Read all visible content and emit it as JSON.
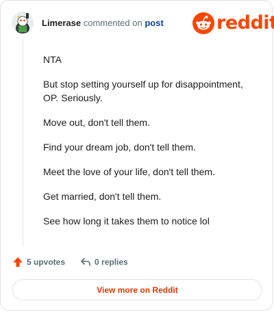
{
  "comment": {
    "username": "Limerase",
    "action_text": "commented on",
    "post_link_label": "post",
    "paragraphs": [
      "NTA",
      "But stop setting yourself up for disappointment, OP. Seriously.",
      "Move out, don't tell them.",
      "Find your dream job, don't tell them.",
      "Meet the love of your life, don't tell them.",
      "Get married, don't tell them.",
      "See how long it takes them to notice lol"
    ]
  },
  "brand": {
    "name": "reddit",
    "logo_icon": "reddit-snoo-icon",
    "color": "#ff4500"
  },
  "actions": {
    "upvotes_label": "5 upvotes",
    "upvote_icon": "upvote-arrow-icon",
    "upvote_color": "#ff4500",
    "replies_label": "0 replies",
    "reply_icon": "reply-arrow-icon"
  },
  "footer": {
    "view_button_label": "View more on Reddit"
  }
}
